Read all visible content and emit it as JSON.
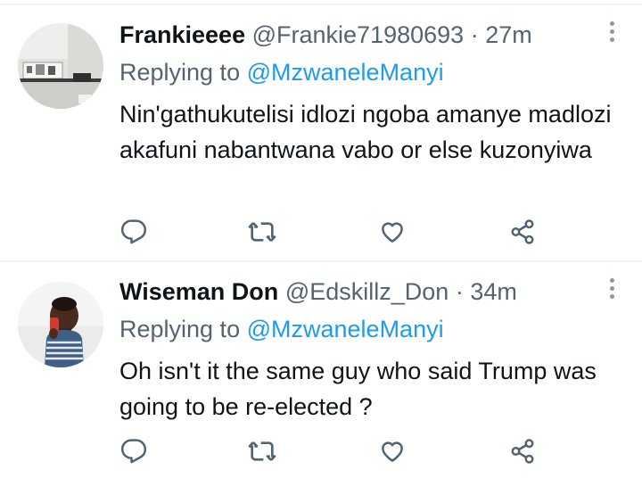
{
  "colors": {
    "accent": "#1d9bf0",
    "text": "#0f1419",
    "muted": "#536471",
    "divider": "#eff3f4"
  },
  "tweets": [
    {
      "display_name": "Frankieeee",
      "handle": "@Frankie71980693",
      "separator": "·",
      "time": "27m",
      "replying_prefix": "Replying to",
      "replying_to": "@MzwaneleManyi",
      "text": "Nin'gathukutelisi idlozi ngoba amanye madlozi akafuni nabantwana vabo or else kuzonyiwa",
      "icons": [
        "reply-icon",
        "retweet-icon",
        "like-icon",
        "share-icon",
        "more-icon"
      ]
    },
    {
      "display_name": "Wiseman Don",
      "handle": "@Edskillz_Don",
      "separator": "·",
      "time": "34m",
      "replying_prefix": "Replying to",
      "replying_to": "@MzwaneleManyi",
      "text": "Oh isn't it the same guy who said Trump was going to be re-elected ?",
      "icons": [
        "reply-icon",
        "retweet-icon",
        "like-icon",
        "share-icon",
        "more-icon"
      ]
    }
  ]
}
